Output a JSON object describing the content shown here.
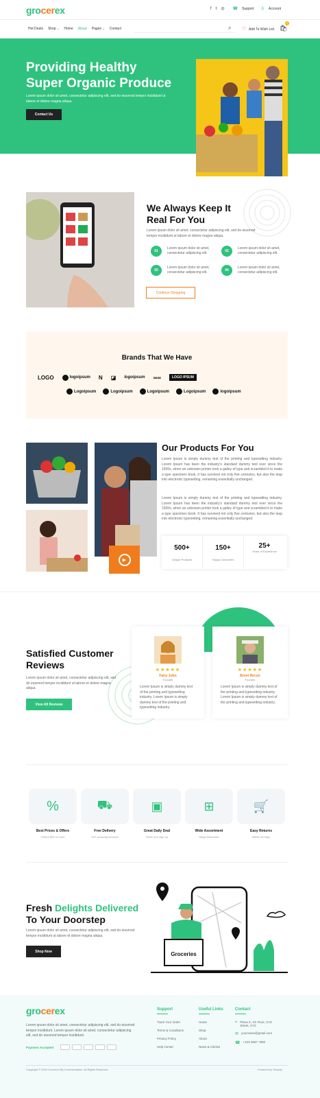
{
  "brand": {
    "logo_part1": "gro",
    "logo_part2": "cer",
    "logo_part3": "ex"
  },
  "topbar": {
    "support": "Support",
    "account": "Account"
  },
  "nav": {
    "items": [
      "Hot Deals",
      "Shop",
      "Home",
      "About",
      "Pages",
      "Contact"
    ],
    "active": "About",
    "wishlist": "Add To Wish List",
    "cart_count": "0"
  },
  "hero": {
    "title_line1": "Providing Healthy",
    "title_line2": "Super Organic Produce",
    "text": "Lorem ipsum dolor sit amet, consectetur adipiscing elit, sed do eiusmod tempor incididunt ut labore et dolore magna aliqua.",
    "button": "Contact Us"
  },
  "about": {
    "title_line1": "We Always Keep It",
    "title_line2": "Real For You",
    "text": "Lorem ipsum dolor sit amet, consectetur adipiscing elit, sed do eiusmod tempor incididunt ut labore et dolore magna aliqua.",
    "items": [
      {
        "num": "01",
        "text": "Lorem ipsum dolor sit amet, consectetur adipiscing elit."
      },
      {
        "num": "02",
        "text": "Lorem ipsum dolor sit amet, consectetur adipiscing elit."
      },
      {
        "num": "03",
        "text": "Lorem ipsum dolor sit amet, consectetur adipiscing elit."
      },
      {
        "num": "04",
        "text": "Lorem ipsum dolor sit amet, consectetur adipiscing elit."
      }
    ],
    "button": "Continue Shopping"
  },
  "brands": {
    "title": "Brands That We Have",
    "row1": [
      "LOGO",
      "logoipsum",
      "N",
      "",
      "logoipsum",
      "",
      "LOGO IPSUM"
    ],
    "row2": [
      "Logoipsum",
      "Logoipsum",
      "Logoipsum",
      "Logoipsum",
      "logoipsum"
    ]
  },
  "products": {
    "title": "Our Products For You",
    "para1": "Lorem Ipsum is simply dummy text of the printing and typesetting industry. Lorem Ipsum has been the industry's standard dummy text ever since the 1500s, when an unknown printer took a galley of type and scrambled it to make a type specimen book. It has survived not only five centuries, but also the leap into electronic typesetting, remaining essentially unchanged.",
    "para2": "Lorem Ipsum is simply dummy text of the printing and typesetting industry. Lorem Ipsum has been the industry's standard dummy text ever since the 1500s, when an unknown printer took a galley of type and scrambled it to make a type specimen book. It has survived not only five centuries, but also the leap into electronic typesetting, remaining essentially unchanged.",
    "stats": [
      {
        "value": "500+",
        "label": "Unique Products"
      },
      {
        "value": "150+",
        "label": "Happy Customers"
      },
      {
        "value": "25+",
        "label": "Years of Experience"
      }
    ]
  },
  "reviews": {
    "title_line1": "Satisfied Customer",
    "title_line2": "Reviews",
    "text": "Lorem ipsum dolor sit amet, consectetur adipiscing elit, sed do eiusmod tempor incididunt ut labore et dolore magna aliqua.",
    "button": "View All Reviews",
    "cards": [
      {
        "name": "Fairy John",
        "role": "Founder",
        "stars": "★★★★★",
        "text": "Lorem Ipsum is simply dummy text of the printing and typesetting industry. Lorem Ipsum is simply dummy text of the printing and typesetting industry."
      },
      {
        "name": "Broni Recon",
        "role": "Founder",
        "stars": "★★★★★",
        "text": "Lorem Ipsum is simply dummy text of the printing and typesetting industry. Lorem Ipsum is simply dummy text of the printing and typesetting industry."
      }
    ]
  },
  "features": [
    {
      "label": "Best Prices & Offers",
      "sub": "Orders $50 or more"
    },
    {
      "label": "Free Delivery",
      "sub": "24/7 amazing services"
    },
    {
      "label": "Great Daily Deal",
      "sub": "When you sign up"
    },
    {
      "label": "Wide Assortment",
      "sub": "Mega Discounts"
    },
    {
      "label": "Easy Returns",
      "sub": "Within 30 days"
    }
  ],
  "delivery": {
    "title_part1": "Fresh",
    "title_part2": "Delights Delivered",
    "title_line2": "To Your Doorstep",
    "text": "Lorem ipsum dolor sit amet, consectetur adipiscing elit, sed do eiusmod tempor incididunt ut labore et dolore magna aliqua.",
    "button": "Shop Now",
    "box_label": "Groceries"
  },
  "footer": {
    "text": "Lorem ipsum dolor sit amet, consectetur adipiscing elit, sed do eiusmod tempor incididunt. Lorem ipsum dolor sit amet, consectetur adipiscing elit, sed do eiusmod tempor incididunt.",
    "payment_label": "Payment Accepted",
    "support_title": "Support",
    "support_links": [
      "Track Your Order",
      "Terms & Conditions",
      "Privacy Policy",
      "Help Center"
    ],
    "useful_title": "Useful Links",
    "useful_links": [
      "Home",
      "Shop",
      "About",
      "News & Articles"
    ],
    "contact_title": "Contact",
    "address": "Plaza X, XX Floor, XYZ Street, XYZ",
    "email": "yourname@gmail.com",
    "phone": "+123 4567 7890",
    "copyright": "Copyright © 2024 Grocerex By Commercialize. All Rights Reserved.",
    "powered": "Powered by Shopify"
  },
  "colors": {
    "accent": "#2ec27e",
    "orange": "#f07c1d",
    "dark": "#222222"
  }
}
